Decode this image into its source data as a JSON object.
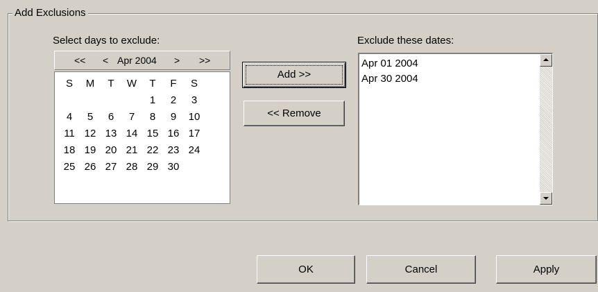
{
  "group": {
    "title": "Add Exclusions"
  },
  "calendar": {
    "label": "Select days to exclude:",
    "nav": {
      "prev_year": "<<",
      "prev_month": "<",
      "month_label": "Apr 2004",
      "next_month": ">",
      "next_year": ">>"
    },
    "weekdays": [
      "S",
      "M",
      "T",
      "W",
      "T",
      "F",
      "S"
    ],
    "weeks": [
      [
        "",
        "",
        "",
        "",
        "1",
        "2",
        "3"
      ],
      [
        "4",
        "5",
        "6",
        "7",
        "8",
        "9",
        "10"
      ],
      [
        "11",
        "12",
        "13",
        "14",
        "15",
        "16",
        "17"
      ],
      [
        "18",
        "19",
        "20",
        "21",
        "22",
        "23",
        "24"
      ],
      [
        "25",
        "26",
        "27",
        "28",
        "29",
        "30",
        ""
      ]
    ]
  },
  "buttons": {
    "add": "Add >>",
    "remove": "<< Remove",
    "ok": "OK",
    "cancel": "Cancel",
    "apply": "Apply"
  },
  "exclusions": {
    "label": "Exclude these dates:",
    "dates": [
      "Apr 01 2004",
      "Apr 30 2004"
    ]
  },
  "icons": {
    "scroll_up": "scroll-up-arrow-icon",
    "scroll_down": "scroll-down-arrow-icon"
  }
}
